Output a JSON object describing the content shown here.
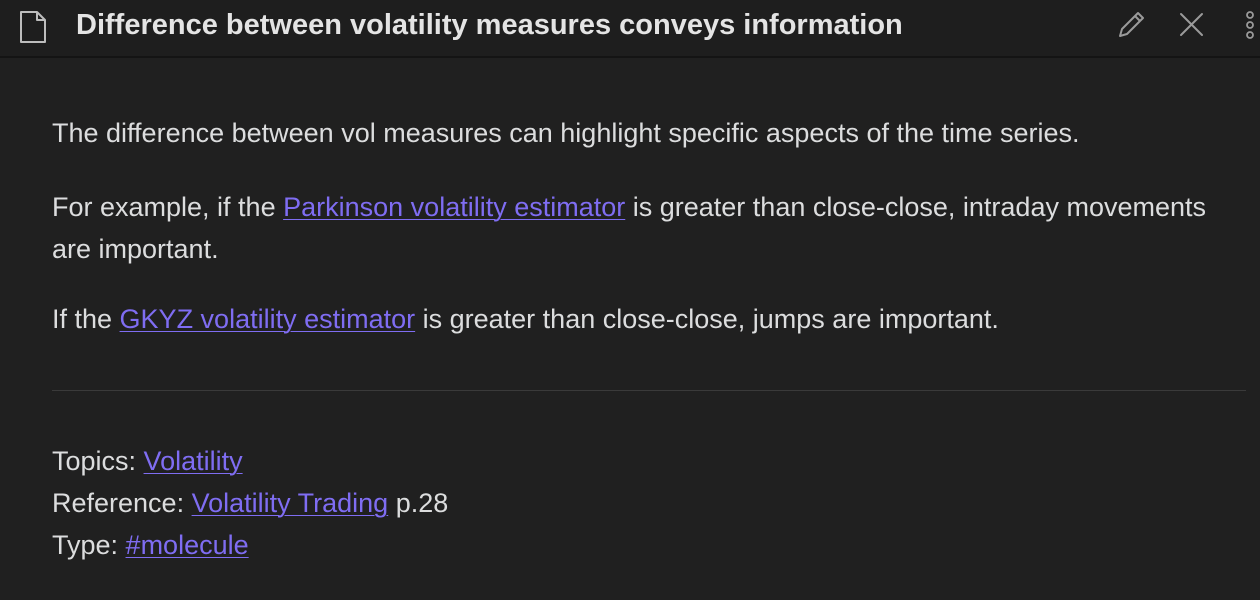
{
  "header": {
    "title": "Difference between volatility measures conveys information",
    "icons": [
      "document-icon",
      "pencil-icon",
      "close-icon",
      "more-vertical-icon"
    ]
  },
  "body": {
    "p1": "The difference between vol measures can highlight specific aspects of the time series.",
    "p2": {
      "before": "For example, if the ",
      "link": "Parkinson volatility estimator",
      "after": " is greater than close-close, intraday movements are important."
    },
    "p3": {
      "before": "If the ",
      "link": "GKYZ volatility estimator",
      "after": " is greater than close-close, jumps are important."
    }
  },
  "meta": {
    "topics_label": "Topics: ",
    "topics_link": "Volatility",
    "reference_label": "Reference: ",
    "reference_link": "Volatility Trading",
    "reference_suffix": " p.28",
    "type_label": "Type: ",
    "type_link": "#molecule"
  },
  "colors": {
    "background": "#202020",
    "text": "#dcddde",
    "link": "#7f6df2"
  }
}
